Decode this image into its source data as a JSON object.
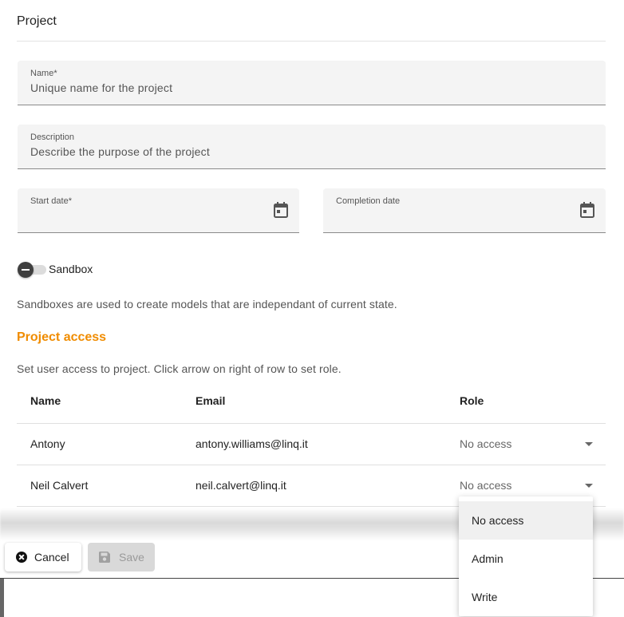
{
  "page": {
    "title": "Project"
  },
  "form": {
    "name": {
      "label": "Name*",
      "placeholder": "Unique name for the project"
    },
    "description": {
      "label": "Description",
      "placeholder": "Describe the purpose of the project"
    },
    "start_date": {
      "label": "Start date*",
      "value": ""
    },
    "completion_date": {
      "label": "Completion date",
      "value": ""
    },
    "sandbox": {
      "label": "Sandbox",
      "checked": false,
      "help": "Sandboxes are used to create models that are independant of current state."
    }
  },
  "access": {
    "title": "Project access",
    "help": "Set user access to project. Click arrow on right of row to set role.",
    "columns": [
      "Name",
      "Email",
      "Role"
    ],
    "rows": [
      {
        "name": "Antony",
        "email": "antony.williams@linq.it",
        "role": "No access"
      },
      {
        "name": "Neil Calvert",
        "email": "neil.calvert@linq.it",
        "role": "No access"
      }
    ]
  },
  "actions": {
    "cancel": "Cancel",
    "save": "Save"
  },
  "role_menu": {
    "options": [
      "No access",
      "Admin",
      "Write"
    ],
    "selected": "No access"
  },
  "colors": {
    "accent": "#f08c00",
    "field_bg": "#f4f4f4",
    "disabled_bg": "#d9d9d9"
  },
  "icons": {
    "calendar": "calendar-icon",
    "cancel": "cancel-circle-icon",
    "save": "save-floppy-icon",
    "dropdown": "arrow-drop-down-icon"
  }
}
